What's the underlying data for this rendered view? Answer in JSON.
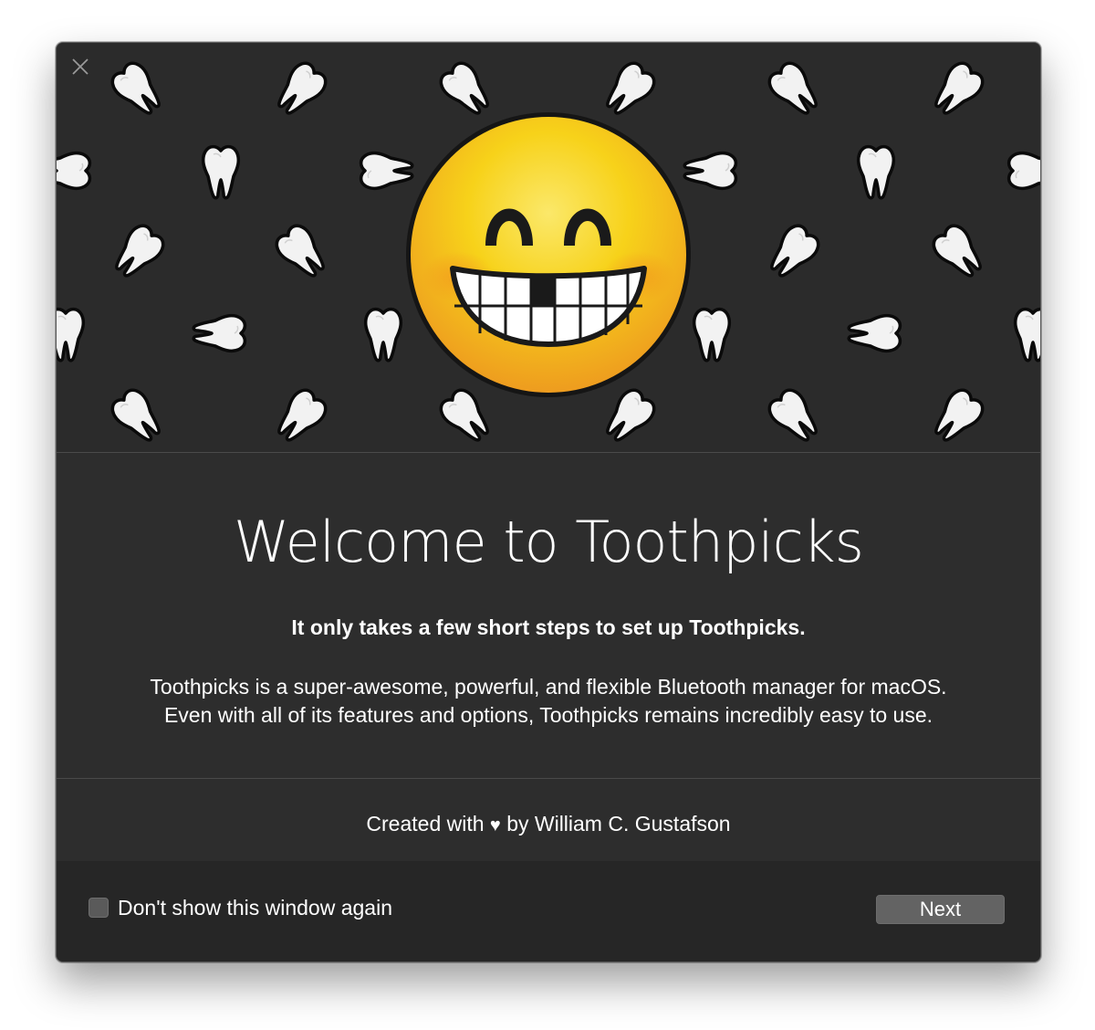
{
  "window": {
    "close_icon": "close-icon"
  },
  "hero": {
    "emoji": "grinning-face-missing-tooth",
    "pattern_icon": "tooth-icon",
    "colors": {
      "background": "#2b2b2b",
      "tooth_fill": "#f2f2f2",
      "emoji_yellow": "#f7d21a",
      "emoji_orange": "#ee9c1f"
    }
  },
  "content": {
    "title": "Welcome to Toothpicks",
    "subtitle": "It only takes a few short steps to set up Toothpicks.",
    "description_line1": "Toothpicks is a super-awesome, powerful, and flexible Bluetooth manager for macOS.",
    "description_line2": "Even with all of its features and options, Toothpicks remains incredibly easy to use."
  },
  "credit": {
    "prefix": "Created with",
    "heart": "♥",
    "suffix": "by William C. Gustafson"
  },
  "footer": {
    "checkbox_label": "Don't show this window again",
    "checkbox_checked": false,
    "next_label": "Next"
  }
}
